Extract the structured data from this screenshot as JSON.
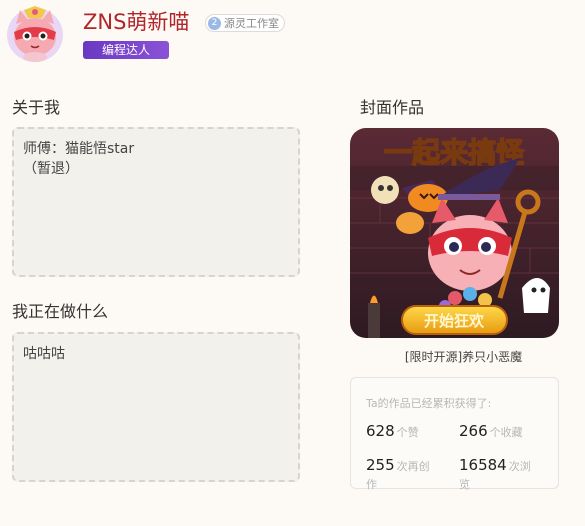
{
  "profile": {
    "username": "ZNS萌新喵",
    "studio_level": "2",
    "studio_name": "源灵工作室",
    "badge": "编程达人"
  },
  "about": {
    "title": "关于我",
    "line1": "师傅：猫能悟star",
    "line2": "（暂退）"
  },
  "doing": {
    "title": "我正在做什么",
    "text": "咕咕咕"
  },
  "cover": {
    "title": "封面作品",
    "banner_text": "一起来搞怪",
    "button_text": "开始狂欢",
    "work_name": "[限时开源]养只小恶魔"
  },
  "stats": {
    "title": "Ta的作品已经累积获得了:",
    "likes": "628",
    "likes_unit": "个赞",
    "favorites": "266",
    "favorites_unit": "个收藏",
    "remixes": "255",
    "remixes_unit": "次再创",
    "remixes_unit2": "作",
    "views": "16584",
    "views_unit": "次浏",
    "views_unit2": "览"
  },
  "colors": {
    "username": "#b1262b",
    "badge_start": "#6a38c2",
    "badge_end": "#8b52d6",
    "background": "#fdf9f4"
  }
}
